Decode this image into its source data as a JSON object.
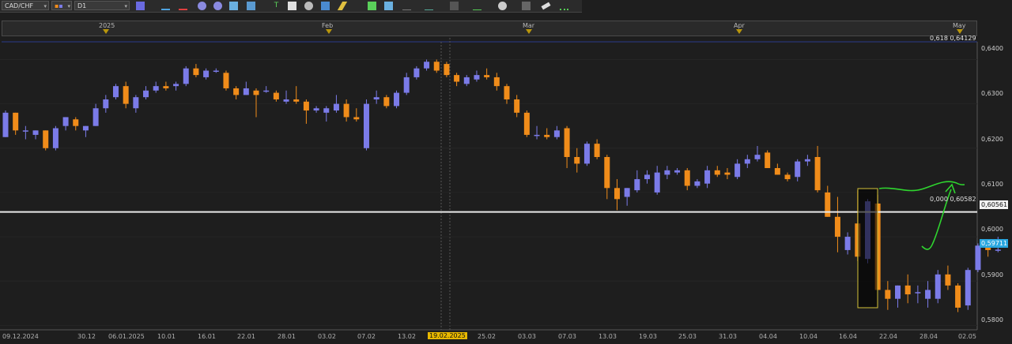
{
  "toolbar": {
    "symbol": "CAD/CHF",
    "timeframe": "D1"
  },
  "time_bar": {
    "labels": [
      "2025",
      "Feb",
      "Mar",
      "Apr",
      "May"
    ]
  },
  "price_axis": {
    "ticks": [
      "0,6400",
      "0,6300",
      "0,6200",
      "0,6100",
      "0,6000",
      "0,5900",
      "0,5800"
    ],
    "current_price": "0,59711",
    "line_price": "0,60561"
  },
  "fib_levels": {
    "top": "0,618 0,64129",
    "bottom": "0,000 0,60582"
  },
  "date_axis": {
    "labels": [
      "09.12.2024",
      "30.12",
      "06.01.2025",
      "10.01",
      "16.01",
      "22.01",
      "28.01",
      "03.02",
      "07.02",
      "13.02",
      "19.02.2025",
      "25.02",
      "03.03",
      "07.03",
      "13.03",
      "19.03",
      "25.03",
      "31.03",
      "04.04",
      "10.04",
      "16.04",
      "22.04",
      "28.04",
      "02.05"
    ]
  },
  "colors": {
    "bull": "#7b7be8",
    "bear": "#f08c1a",
    "background": "#1e1e1e",
    "horizontal_line": "#e8e8e8",
    "annotation": "#2fd62f",
    "highlight": "#d4c23a",
    "current_badge": "#2aa7e0"
  },
  "chart_data": {
    "type": "candlestick",
    "ohlc": [
      [
        0.6225,
        0.6285,
        0.6225,
        0.628
      ],
      [
        0.628,
        0.628,
        0.623,
        0.624
      ],
      [
        0.624,
        0.625,
        0.622,
        0.624
      ],
      [
        0.623,
        0.624,
        0.622,
        0.624
      ],
      [
        0.624,
        0.624,
        0.6195,
        0.62
      ],
      [
        0.62,
        0.625,
        0.6195,
        0.6245
      ],
      [
        0.625,
        0.627,
        0.624,
        0.627
      ],
      [
        0.6265,
        0.627,
        0.624,
        0.625
      ],
      [
        0.624,
        0.625,
        0.6225,
        0.625
      ],
      [
        0.625,
        0.63,
        0.625,
        0.629
      ],
      [
        0.629,
        0.632,
        0.628,
        0.631
      ],
      [
        0.6315,
        0.6345,
        0.631,
        0.634
      ],
      [
        0.634,
        0.635,
        0.629,
        0.63
      ],
      [
        0.629,
        0.632,
        0.628,
        0.6315
      ],
      [
        0.6315,
        0.634,
        0.631,
        0.633
      ],
      [
        0.633,
        0.635,
        0.6325,
        0.634
      ],
      [
        0.634,
        0.635,
        0.633,
        0.6335
      ],
      [
        0.634,
        0.635,
        0.633,
        0.6345
      ],
      [
        0.6345,
        0.6385,
        0.634,
        0.638
      ],
      [
        0.638,
        0.639,
        0.636,
        0.6365
      ],
      [
        0.636,
        0.638,
        0.6355,
        0.6375
      ],
      [
        0.6375,
        0.638,
        0.637,
        0.6375
      ],
      [
        0.637,
        0.6375,
        0.633,
        0.6335
      ],
      [
        0.6335,
        0.634,
        0.631,
        0.632
      ],
      [
        0.632,
        0.635,
        0.632,
        0.6335
      ],
      [
        0.633,
        0.6335,
        0.627,
        0.632
      ],
      [
        0.633,
        0.634,
        0.6325,
        0.633
      ],
      [
        0.6325,
        0.633,
        0.6305,
        0.631
      ],
      [
        0.6305,
        0.633,
        0.63,
        0.631
      ],
      [
        0.631,
        0.634,
        0.63,
        0.6305
      ],
      [
        0.6305,
        0.631,
        0.6255,
        0.6285
      ],
      [
        0.6285,
        0.6295,
        0.628,
        0.629
      ],
      [
        0.628,
        0.6295,
        0.626,
        0.629
      ],
      [
        0.6285,
        0.632,
        0.628,
        0.63
      ],
      [
        0.63,
        0.631,
        0.626,
        0.627
      ],
      [
        0.627,
        0.629,
        0.626,
        0.6265
      ],
      [
        0.62,
        0.631,
        0.6195,
        0.63
      ],
      [
        0.631,
        0.633,
        0.63,
        0.6315
      ],
      [
        0.6315,
        0.632,
        0.629,
        0.6295
      ],
      [
        0.6295,
        0.633,
        0.629,
        0.6325
      ],
      [
        0.6325,
        0.637,
        0.632,
        0.636
      ],
      [
        0.636,
        0.6385,
        0.6355,
        0.638
      ],
      [
        0.638,
        0.64,
        0.6375,
        0.6395
      ],
      [
        0.6395,
        0.64,
        0.637,
        0.6375
      ],
      [
        0.639,
        0.6395,
        0.636,
        0.6365
      ],
      [
        0.6365,
        0.637,
        0.634,
        0.635
      ],
      [
        0.6345,
        0.6365,
        0.634,
        0.636
      ],
      [
        0.6355,
        0.6375,
        0.635,
        0.6365
      ],
      [
        0.6365,
        0.638,
        0.6355,
        0.636
      ],
      [
        0.636,
        0.637,
        0.633,
        0.634
      ],
      [
        0.634,
        0.6345,
        0.63,
        0.631
      ],
      [
        0.631,
        0.632,
        0.627,
        0.628
      ],
      [
        0.628,
        0.6285,
        0.6225,
        0.623
      ],
      [
        0.623,
        0.625,
        0.622,
        0.623
      ],
      [
        0.623,
        0.6245,
        0.622,
        0.6225
      ],
      [
        0.6225,
        0.625,
        0.622,
        0.624
      ],
      [
        0.6245,
        0.625,
        0.6155,
        0.618
      ],
      [
        0.618,
        0.62,
        0.6145,
        0.6165
      ],
      [
        0.6165,
        0.6215,
        0.616,
        0.621
      ],
      [
        0.621,
        0.622,
        0.6175,
        0.618
      ],
      [
        0.618,
        0.6185,
        0.6085,
        0.611
      ],
      [
        0.611,
        0.613,
        0.606,
        0.6085
      ],
      [
        0.609,
        0.611,
        0.607,
        0.611
      ],
      [
        0.6105,
        0.615,
        0.61,
        0.613
      ],
      [
        0.613,
        0.615,
        0.612,
        0.614
      ],
      [
        0.61,
        0.616,
        0.6095,
        0.6145
      ],
      [
        0.614,
        0.616,
        0.613,
        0.615
      ],
      [
        0.6145,
        0.6155,
        0.614,
        0.615
      ],
      [
        0.615,
        0.6155,
        0.6105,
        0.6115
      ],
      [
        0.6115,
        0.613,
        0.611,
        0.6125
      ],
      [
        0.612,
        0.616,
        0.611,
        0.615
      ],
      [
        0.615,
        0.616,
        0.6135,
        0.614
      ],
      [
        0.6145,
        0.6155,
        0.613,
        0.614
      ],
      [
        0.6135,
        0.6175,
        0.613,
        0.6165
      ],
      [
        0.6165,
        0.6185,
        0.6155,
        0.6175
      ],
      [
        0.6175,
        0.6205,
        0.617,
        0.6185
      ],
      [
        0.619,
        0.6195,
        0.616,
        0.6155
      ],
      [
        0.6155,
        0.6165,
        0.614,
        0.614
      ],
      [
        0.614,
        0.6145,
        0.6125,
        0.613
      ],
      [
        0.6135,
        0.6175,
        0.6125,
        0.617
      ],
      [
        0.617,
        0.6185,
        0.616,
        0.6175
      ],
      [
        0.618,
        0.6205,
        0.61,
        0.6105
      ],
      [
        0.61,
        0.6115,
        0.6045,
        0.6045
      ],
      [
        0.6045,
        0.609,
        0.5965,
        0.6
      ],
      [
        0.597,
        0.601,
        0.596,
        0.6
      ],
      [
        0.603,
        0.6105,
        0.5945,
        0.5955
      ],
      [
        0.595,
        0.6085,
        0.594,
        0.608
      ],
      [
        0.6075,
        0.6095,
        0.5885,
        0.588
      ],
      [
        0.588,
        0.59,
        0.5835,
        0.586
      ],
      [
        0.586,
        0.589,
        0.584,
        0.589
      ],
      [
        0.589,
        0.5915,
        0.585,
        0.587
      ],
      [
        0.5875,
        0.589,
        0.585,
        0.5875
      ],
      [
        0.586,
        0.59,
        0.584,
        0.588
      ],
      [
        0.586,
        0.5925,
        0.585,
        0.5915
      ],
      [
        0.5915,
        0.5935,
        0.588,
        0.589
      ],
      [
        0.589,
        0.5895,
        0.583,
        0.584
      ],
      [
        0.5845,
        0.593,
        0.5835,
        0.5925
      ],
      [
        0.5925,
        0.5985,
        0.592,
        0.598
      ],
      [
        0.5985,
        0.599,
        0.5955,
        0.597
      ],
      [
        0.597,
        0.6,
        0.5965,
        0.5971
      ]
    ],
    "ylim": [
      0.579,
      0.644
    ],
    "horizontal_line": 0.6056,
    "grid": true
  }
}
